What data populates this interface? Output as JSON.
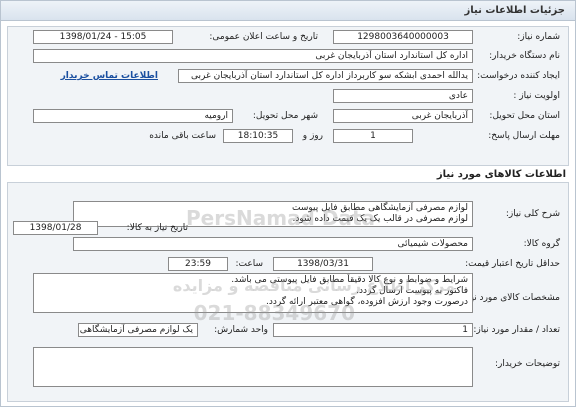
{
  "header": {
    "title": "جزئیات اطلاعات نیاز"
  },
  "fields": {
    "need_number_label": "شماره نیاز:",
    "need_number": "1298003640000003",
    "announce_label": "تاریخ و ساعت اعلان عمومی:",
    "announce_value": "1398/01/24 - 15:05",
    "buyer_org_label": "نام دستگاه خریدار:",
    "buyer_org": "اداره کل استاندارد استان آذربایجان غربی",
    "creator_label": "ایجاد کننده درخواست:",
    "creator": "یدالله  احمدی ابشکه سو کاربرداز اداره کل استاندارد استان آذربایجان غربی",
    "contact_link": "اطلاعات تماس خریدار",
    "priority_label": "اولویت نیاز :",
    "priority": "عادی",
    "delivery_province_label": "استان محل تحویل:",
    "delivery_province": "آذربایجان غربی",
    "delivery_city_label": "شهر محل تحویل:",
    "delivery_city": "ارومیه",
    "deadline_label": "مهلت ارسال پاسخ:",
    "deadline_days": "1",
    "day_and_label": "روز و",
    "deadline_time": "18:10:35",
    "remaining_label": "ساعت باقی مانده"
  },
  "goods": {
    "title": "اطلاعات کالاهای مورد نیاز",
    "summary_label": "شرح کلی نیاز:",
    "summary_line1": "لوازم مصرفی آزمایشگاهی مطابق فایل پیوست",
    "summary_line2": "لوازم مصرفی در قالب یک یک قیمت داده شود.",
    "group_label": "گروه کالا:",
    "group": "محصولات شیمیائی",
    "need_date_label": "تاریخ نیاز به کالا:",
    "need_date": "1398/01/28",
    "min_validity_label": "حداقل تاریخ اعتبار قیمت:",
    "validity_date": "1398/03/31",
    "validity_hour_label": "ساعت:",
    "validity_hour": "23:59",
    "specs_label": "مشخصات کالای مورد نیاز:",
    "specs_line1": "شرایط و ضوابط و نوع کالا دقیقاً مطابق فایل پیوستی می باشد.",
    "specs_line2": "فاکتور به پیوست ارسال گردد.",
    "specs_line3": "درصورت وجود ارزش افزوده، گواهی معتبر ارائه گردد.",
    "qty_label": "تعداد / مقدار مورد نیاز:",
    "qty": "1",
    "unit_label": "واحد شمارش:",
    "unit": "یک لوازم مصرفی آزمایشگاهی",
    "buyer_notes_label": "توضیحات خریدار:",
    "buyer_notes": ""
  },
  "watermark": {
    "brand": "PersNamad Data",
    "line1": "مرکز اطلاع رسانی مناقصه و مزایده",
    "phone": "021-88349670"
  }
}
